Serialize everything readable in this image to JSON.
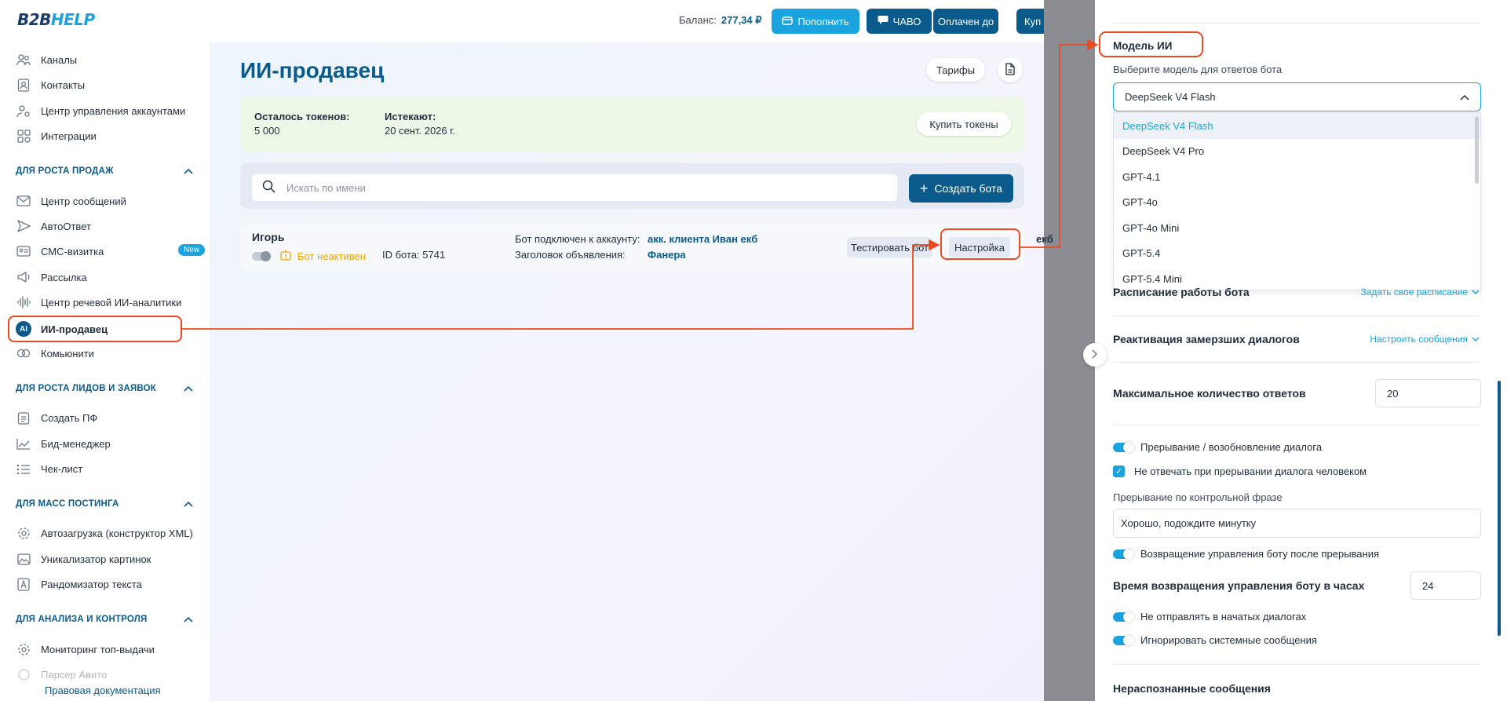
{
  "header": {
    "logo_main": "B2B",
    "logo_accent": "HELP",
    "balance_label": "Баланс:",
    "balance_value": "277,34 ₽",
    "topup_label": "Пополнить",
    "faq_label": "ЧАВО",
    "paid_label": "Оплачен до",
    "buy_label": "Куп"
  },
  "sidebar": {
    "items_top": [
      {
        "label": "Каналы",
        "icon": "channels-icon"
      },
      {
        "label": "Контакты",
        "icon": "contacts-icon"
      },
      {
        "label": "Центр управления аккаунтами",
        "icon": "accounts-icon"
      },
      {
        "label": "Интеграции",
        "icon": "integrations-icon"
      }
    ],
    "section_sales": "ДЛЯ РОСТА ПРОДАЖ",
    "items_sales": [
      {
        "label": "Центр сообщений",
        "icon": "mail-icon"
      },
      {
        "label": "АвтоОтвет",
        "icon": "send-icon"
      },
      {
        "label": "СМС-визитка",
        "icon": "card-icon"
      },
      {
        "label": "Рассылка",
        "icon": "broadcast-icon"
      },
      {
        "label": "Центр речевой ИИ-аналитики",
        "icon": "voice-icon"
      },
      {
        "label": "ИИ-продавец",
        "icon": "ai-icon"
      },
      {
        "label": "Комьюнити",
        "icon": "community-icon"
      }
    ],
    "new_badge": "New",
    "ai_badge_text": "AI",
    "section_leads": "ДЛЯ РОСТА ЛИДОВ И ЗАЯВОК",
    "items_leads": [
      {
        "label": "Создать ПФ",
        "icon": "checklist-icon"
      },
      {
        "label": "Бид-менеджер",
        "icon": "chart-icon"
      },
      {
        "label": "Чек-лист",
        "icon": "list-icon"
      }
    ],
    "section_posting": "ДЛЯ МАСС ПОСТИНГА",
    "items_posting": [
      {
        "label": "Автозагрузка (конструктор XML)",
        "icon": "settings-icon"
      },
      {
        "label": "Уникализатор картинок",
        "icon": "image-icon"
      },
      {
        "label": "Рандомизатор текста",
        "icon": "text-icon"
      }
    ],
    "section_analysis": "ДЛЯ АНАЛИЗА И КОНТРОЛЯ",
    "items_analysis": [
      {
        "label": "Мониторинг топ-выдачи",
        "icon": "monitor-icon"
      },
      {
        "label": "Парсер Авито",
        "icon": "parser-icon"
      }
    ],
    "legal_link": "Правовая документация"
  },
  "main": {
    "title": "ИИ-продавец",
    "tariffs_button": "Тарифы",
    "tokens": {
      "left_label": "Осталось токенов:",
      "left_value": "5 000",
      "expires_label": "Истекают:",
      "expires_value": "20 сент. 2026 г.",
      "buy_button": "Купить токены"
    },
    "search_placeholder": "Искать по имени",
    "create_button": "Создать бота",
    "bot": {
      "name": "Игорь",
      "status": "Бот неактивен",
      "id_text": "ID бота: 5741",
      "connected_label": "Бот подключен к аккаунту:",
      "connected_value": "акк. клиента Иван екб",
      "title_label": "Заголовок объявления:",
      "title_value": "Фанера",
      "test_button": "Тестировать бот",
      "settings_button": "Настройка",
      "cut_text": "екб"
    }
  },
  "panel": {
    "model_title": "Модель ИИ",
    "model_hint": "Выберите модель для ответов бота",
    "selected_model": "DeepSeek V4 Flash",
    "model_options": [
      "DeepSeek V4 Flash",
      "DeepSeek V4 Pro",
      "GPT-4.1",
      "GPT-4o",
      "GPT-4o Mini",
      "GPT-5.4",
      "GPT-5.4 Mini"
    ],
    "schedule_label": "Расписание работы бота",
    "schedule_link": "Задать свое расписание",
    "reactivation_label": "Реактивация замерзших диалогов",
    "reactivation_link": "Настроить сообщения",
    "max_answers_label": "Максимальное количество ответов",
    "max_answers_value": "20",
    "interrupt_switch": "Прерывание / возобновление диалога",
    "no_reply_checkbox": "Не отвечать при прерывании диалога человеком",
    "phrase_label": "Прерывание по контрольной фразе",
    "phrase_value": "Хорошо, подождите минутку",
    "return_switch": "Возвращение управления боту после прерывания",
    "return_hours_label": "Время возвращения управления боту в часах",
    "return_hours_value": "24",
    "not_send_switch": "Не отправлять в начатых диалогах",
    "ignore_switch": "Игнорировать системные сообщения",
    "unrecognized_label": "Нераспознанные сообщения"
  },
  "colors": {
    "primary": "#0a5a8c",
    "accent": "#1aa3df",
    "highlight": "#ec4a1f",
    "tokens_bg": "#eef8e6",
    "status_warning": "#e8a600"
  }
}
